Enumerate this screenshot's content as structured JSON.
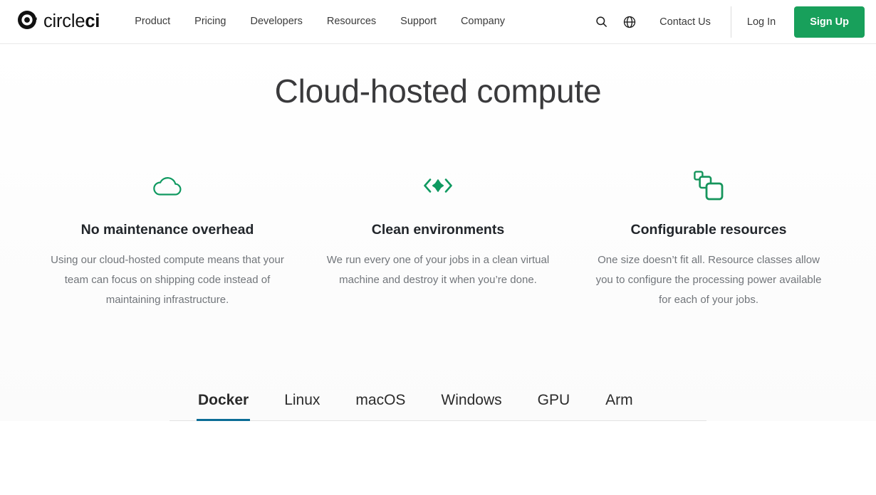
{
  "header": {
    "brand": {
      "icon": "circleci-logo-icon",
      "text_light": "circle",
      "text_bold": "ci"
    },
    "nav": [
      {
        "label": "Product"
      },
      {
        "label": "Pricing"
      },
      {
        "label": "Developers"
      },
      {
        "label": "Resources"
      },
      {
        "label": "Support"
      },
      {
        "label": "Company"
      }
    ],
    "search_icon": "search-icon",
    "globe_icon": "globe-icon",
    "contact_label": "Contact Us",
    "login_label": "Log In",
    "signup_label": "Sign Up",
    "signup_color": "#18a05b"
  },
  "hero": {
    "title": "Cloud-hosted compute"
  },
  "features": [
    {
      "icon": "cloud-icon",
      "title": "No maintenance overhead",
      "body": "Using our cloud-hosted compute means that your team can focus on shipping code instead of maintaining infrastructure."
    },
    {
      "icon": "code-brackets-icon",
      "title": "Clean environments",
      "body": "We run every one of your jobs in a clean virtual machine and destroy it when you’re done."
    },
    {
      "icon": "stacked-squares-icon",
      "title": "Configurable resources",
      "body": "One size doesn’t fit all. Resource classes allow you to configure the processing power available for each of your jobs."
    }
  ],
  "tabs": {
    "active_color": "#0b6d96",
    "items": [
      {
        "label": "Docker",
        "active": true
      },
      {
        "label": "Linux",
        "active": false
      },
      {
        "label": "macOS",
        "active": false
      },
      {
        "label": "Windows",
        "active": false
      },
      {
        "label": "GPU",
        "active": false
      },
      {
        "label": "Arm",
        "active": false
      }
    ]
  },
  "theme": {
    "accent_green": "#178f53",
    "text_dark": "#22262b",
    "text_muted": "#71757a"
  }
}
